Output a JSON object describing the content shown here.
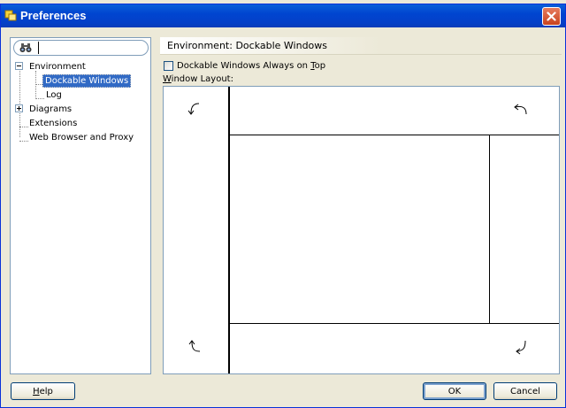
{
  "window": {
    "title": "Preferences"
  },
  "search": {
    "value": "",
    "placeholder": ""
  },
  "tree": {
    "items": [
      {
        "label": "Environment",
        "expander": "minus"
      },
      {
        "label": "Dockable Windows",
        "selected": true
      },
      {
        "label": "Log"
      },
      {
        "label": "Diagrams",
        "expander": "plus"
      },
      {
        "label": "Extensions"
      },
      {
        "label": "Web Browser and Proxy"
      }
    ]
  },
  "panel": {
    "title": "Environment: Dockable Windows",
    "checkbox_label_pre": "Dockable Windows Always on ",
    "checkbox_label_key": "T",
    "checkbox_label_post": "op",
    "checkbox_checked": false,
    "layout_label_key": "W",
    "layout_label_post": "indow Layout:"
  },
  "buttons": {
    "help_key": "H",
    "help_post": "elp",
    "ok": "OK",
    "cancel": "Cancel"
  },
  "icons": {
    "title": "preferences-icon",
    "close": "close-icon",
    "search": "binoculars-icon",
    "rotate": "rotate-arrow-icon"
  },
  "colors": {
    "titlebar": "#0045d0",
    "selection": "#316ac5",
    "dialog_bg": "#ece9d8",
    "close_button": "#c8421e"
  }
}
